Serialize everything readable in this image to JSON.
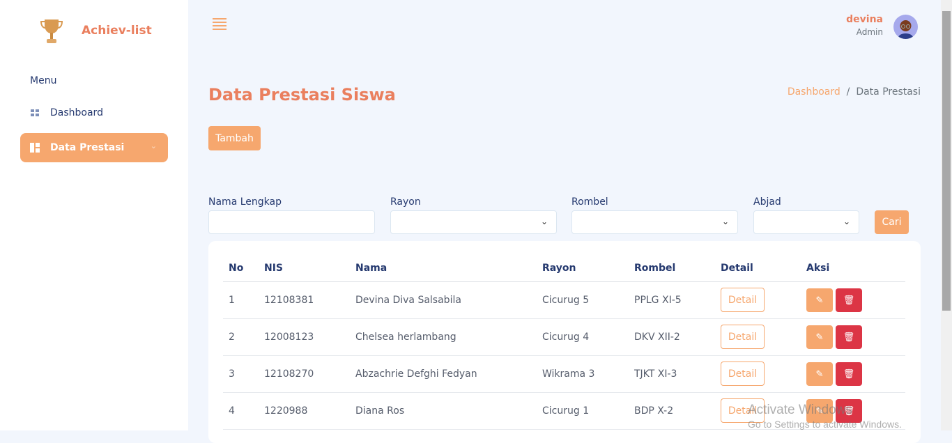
{
  "brand": {
    "name": "Achiev-list",
    "logo_icon": "trophy-icon"
  },
  "sidebar": {
    "menu_title": "Menu",
    "items": [
      {
        "label": "Dashboard",
        "icon": "grid-icon"
      },
      {
        "label": "Data Prestasi",
        "icon": "layout-icon",
        "active": true
      }
    ]
  },
  "header": {
    "user_name": "devina",
    "user_role": "Admin"
  },
  "page": {
    "title": "Data Prestasi Siswa",
    "breadcrumb": [
      "Dashboard",
      "Data Prestasi"
    ],
    "add_label": "Tambah"
  },
  "filters": {
    "nama_label": "Nama Lengkap",
    "rayon_label": "Rayon",
    "rombel_label": "Rombel",
    "abjad_label": "Abjad",
    "nama_value": "",
    "search_label": "Cari"
  },
  "table": {
    "headers": [
      "No",
      "NIS",
      "Nama",
      "Rayon",
      "Rombel",
      "Detail",
      "Aksi"
    ],
    "detail_label": "Detail",
    "rows": [
      [
        "1",
        "12108381",
        "Devina Diva Salsabila",
        "Cicurug 5",
        "PPLG XI-5"
      ],
      [
        "2",
        "12008123",
        "Chelsea herlambang",
        "Cicurug 4",
        "DKV XII-2"
      ],
      [
        "3",
        "12108270",
        "Abzachrie Defghi Fedyan",
        "Wikrama 3",
        "TJKT XI-3"
      ],
      [
        "4",
        "1220988",
        "Diana Ros",
        "Cicurug 1",
        "BDP X-2"
      ]
    ]
  },
  "watermark": {
    "line1": "Activate Windows",
    "line2": "Go to Settings to activate Windows."
  },
  "colors": {
    "accent": "#f6a76e",
    "title": "#ea7f5e",
    "danger": "#dc3545",
    "bg": "#f2f6fd"
  }
}
